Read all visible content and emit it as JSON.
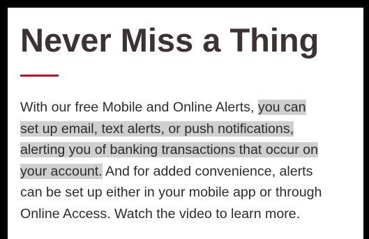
{
  "content": {
    "heading": "Never Miss a Thing",
    "accent_color": "#a6192e",
    "paragraph_lines": [
      {
        "plain": "With our free Mobile and Online Alerts,",
        "highlight": "you can"
      },
      {
        "plain": "",
        "highlight": "set up email, text alerts, or push notifications,"
      },
      {
        "plain": "",
        "highlight": "alerting you of banking transactions that occur on"
      },
      {
        "plain": " And for added convenience, alerts",
        "highlight": "your account."
      },
      {
        "plain": "can be set up either in your mobile app or through",
        "highlight": ""
      },
      {
        "plain": "Online Access. Watch the video to learn more.",
        "highlight": ""
      }
    ],
    "selection_color": "#cfcfcf"
  }
}
